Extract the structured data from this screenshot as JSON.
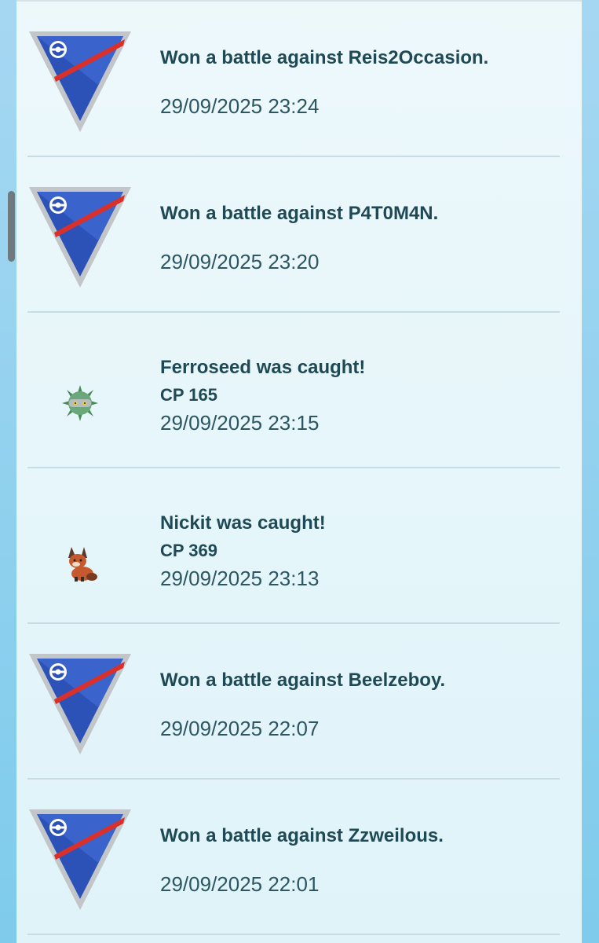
{
  "entries": [
    {
      "type": "battle",
      "icon": "great-league-icon",
      "title": "Won a battle against Reis2Occasion.",
      "timestamp": "29/09/2025 23:24"
    },
    {
      "type": "battle",
      "icon": "great-league-icon",
      "title": "Won a battle against P4T0M4N.",
      "timestamp": "29/09/2025 23:20"
    },
    {
      "type": "catch",
      "icon": "ferroseed-icon",
      "title": "Ferroseed was caught!",
      "cp": "CP 165",
      "timestamp": "29/09/2025 23:15"
    },
    {
      "type": "catch",
      "icon": "nickit-icon",
      "title": "Nickit was caught!",
      "cp": "CP 369",
      "timestamp": "29/09/2025 23:13"
    },
    {
      "type": "battle",
      "icon": "great-league-icon",
      "title": "Won a battle against Beelzeboy.",
      "timestamp": "29/09/2025 22:07"
    },
    {
      "type": "battle",
      "icon": "great-league-icon",
      "title": "Won a battle against Zzweilous.",
      "timestamp": "29/09/2025 22:01"
    }
  ],
  "colors": {
    "league_blue": "#2c52b8",
    "league_red": "#d9302c",
    "text": "#1f4a55"
  }
}
